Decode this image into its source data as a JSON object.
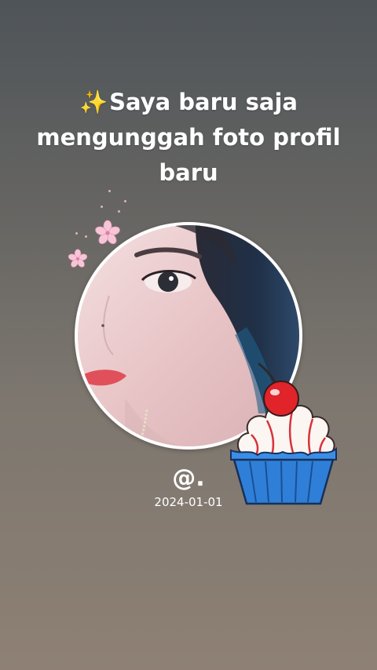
{
  "story": {
    "sparkle_icon": "✨",
    "headline": "Saya baru saja mengunggah foto profil baru",
    "username": "@.",
    "date": "2024-01-01"
  },
  "icons": {
    "sparkle": "sparkle-icon",
    "flowers": "cherry-blossom-icon",
    "cupcake": "cupcake-icon"
  },
  "colors": {
    "background_top": "#4e5458",
    "background_bottom": "#8e8074",
    "text": "#ffffff",
    "frame": "#ffffff",
    "blossom": "#f4c0d4",
    "cupcake_liner": "#2f80d8",
    "cherry": "#e0242a"
  }
}
